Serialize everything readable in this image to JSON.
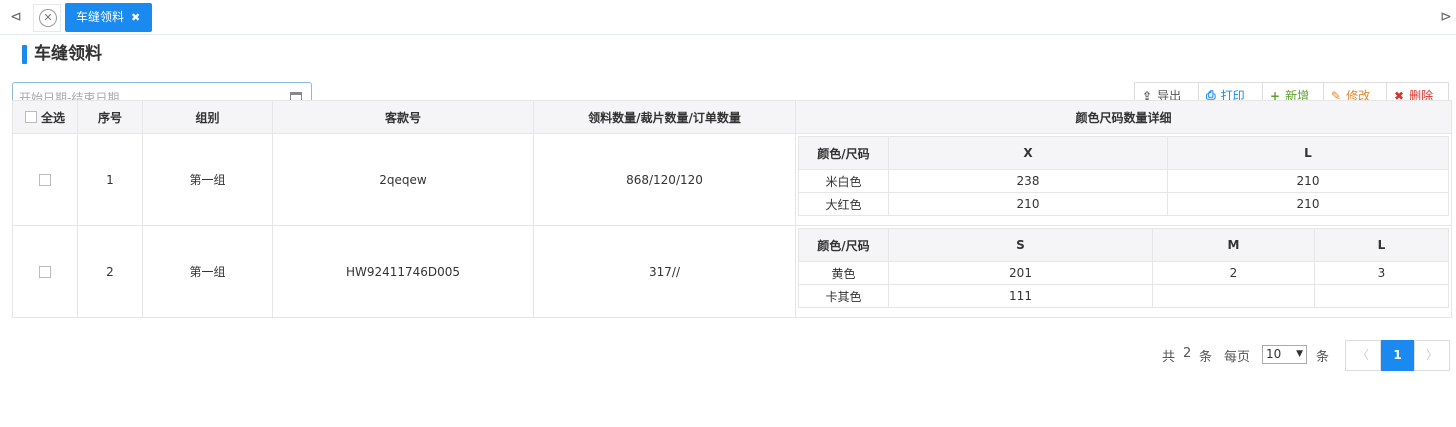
{
  "tabs": {
    "nav_left": "⊲",
    "close_all": "✕",
    "active": {
      "label": "车缝领料",
      "close": "✖"
    },
    "nav_right": "⊳"
  },
  "page": {
    "title": "车缝领料"
  },
  "date_range": {
    "placeholder": "开始日期-结束日期"
  },
  "toolbar": {
    "export": "导出",
    "print": "打印",
    "add": "新增",
    "edit": "修改",
    "delete": "删除"
  },
  "table": {
    "headers": {
      "select_all": "全选",
      "seq": "序号",
      "group": "组别",
      "style_no": "客款号",
      "quantities": "领料数量/裁片数量/订单数量",
      "color_size_detail": "颜色尺码数量详细"
    },
    "rows": [
      {
        "seq": "1",
        "group": "第一组",
        "style_no": "2qeqew",
        "quantities": "868/120/120",
        "detail": {
          "header": "颜色/尺码",
          "sizes": [
            "X",
            "L"
          ],
          "rows": [
            {
              "color": "米白色",
              "values": [
                "238",
                "210"
              ]
            },
            {
              "color": "大红色",
              "values": [
                "210",
                "210"
              ]
            }
          ]
        }
      },
      {
        "seq": "2",
        "group": "第一组",
        "style_no": "HW92411746D005",
        "quantities": "317//",
        "detail": {
          "header": "颜色/尺码",
          "sizes": [
            "S",
            "M",
            "L"
          ],
          "rows": [
            {
              "color": "黄色",
              "values": [
                "201",
                "2",
                "3"
              ]
            },
            {
              "color": "卡其色",
              "values": [
                "111",
                "",
                ""
              ]
            }
          ]
        }
      }
    ]
  },
  "pagination": {
    "total_prefix": "共",
    "total": "2",
    "total_suffix": "条",
    "per_page_label": "每页",
    "page_size": "10",
    "page_size_suffix": "条",
    "prev": "〈",
    "current": "1",
    "next": "〉"
  },
  "colors": {
    "accent": "#1a8af0",
    "add": "#5aa02c",
    "edit": "#e0872c",
    "delete": "#d9302c"
  }
}
